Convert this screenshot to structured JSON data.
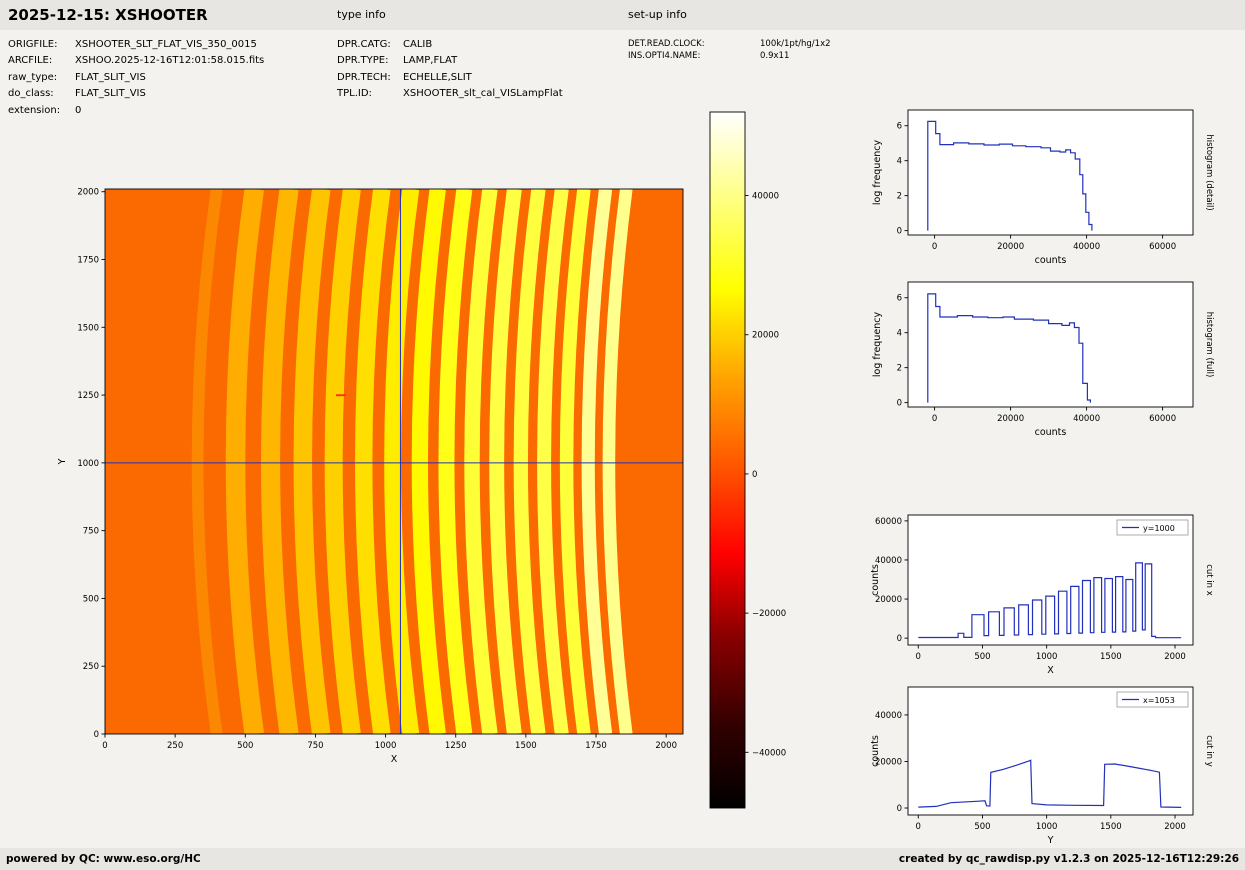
{
  "header": {
    "title": "2025-12-15: XSHOOTER",
    "type_info_label": "type info",
    "setup_info_label": "set-up info",
    "left_fields": [
      {
        "label": "ORIGFILE:",
        "value": "XSHOOTER_SLT_FLAT_VIS_350_0015"
      },
      {
        "label": "ARCFILE:",
        "value": "XSHOO.2025-12-16T12:01:58.015.fits"
      },
      {
        "label": "raw_type:",
        "value": "FLAT_SLIT_VIS"
      },
      {
        "label": "do_class:",
        "value": "FLAT_SLIT_VIS"
      },
      {
        "label": "extension:",
        "value": "0"
      }
    ],
    "type_fields": [
      {
        "label": "DPR.CATG:",
        "value": "CALIB"
      },
      {
        "label": "DPR.TYPE:",
        "value": "LAMP,FLAT"
      },
      {
        "label": "DPR.TECH:",
        "value": "ECHELLE,SLIT"
      },
      {
        "label": "TPL.ID:",
        "value": "XSHOOTER_slt_cal_VISLampFlat"
      }
    ],
    "setup_fields": [
      {
        "label": "DET.READ.CLOCK:",
        "value": "100k/1pt/hg/1x2"
      },
      {
        "label": "INS.OPTI4.NAME:",
        "value": "0.9x11"
      }
    ]
  },
  "footer": {
    "left": "powered by QC: www.eso.org/HC",
    "right": "created by qc_rawdisp.py v1.2.3 on 2025-12-16T12:29:26"
  },
  "chart_data": [
    {
      "id": "main_image",
      "type": "heatmap",
      "title": "",
      "xlabel": "X",
      "ylabel": "Y",
      "xlim": [
        0,
        2060
      ],
      "ylim": [
        0,
        2010
      ],
      "xticks": [
        0,
        250,
        500,
        750,
        1000,
        1250,
        1500,
        1750,
        2000
      ],
      "yticks": [
        0,
        250,
        500,
        750,
        1000,
        1250,
        1500,
        1750,
        2000
      ],
      "bg_color": "#fa6a00",
      "crosshair": {
        "x": 1053,
        "y": 1000,
        "color": "#2230bb"
      },
      "defects": [
        {
          "x": 840,
          "y": 1253,
          "w": 34,
          "h": 7,
          "color": "#fb2e00"
        }
      ],
      "orders": [
        {
          "x": 330,
          "width": 42,
          "bow": 68,
          "color": "#fc8700",
          "value": 6000
        },
        {
          "x": 465,
          "width": 70,
          "bow": 67,
          "color": "#ffad00",
          "value": 12000
        },
        {
          "x": 590,
          "width": 68,
          "bow": 66,
          "color": "#ffb600",
          "value": 13500
        },
        {
          "x": 705,
          "width": 66,
          "bow": 66,
          "color": "#ffc400",
          "value": 15500
        },
        {
          "x": 815,
          "width": 64,
          "bow": 65,
          "color": "#ffd000",
          "value": 17000
        },
        {
          "x": 922,
          "width": 62,
          "bow": 65,
          "color": "#ffdf00",
          "value": 19500
        },
        {
          "x": 1025,
          "width": 60,
          "bow": 65,
          "color": "#ffed00",
          "value": 21500
        },
        {
          "x": 1122,
          "width": 58,
          "bow": 64,
          "color": "#fffa00",
          "value": 24000
        },
        {
          "x": 1217,
          "width": 57,
          "bow": 64,
          "color": "#ffff18",
          "value": 26500
        },
        {
          "x": 1308,
          "width": 55,
          "bow": 64,
          "color": "#ffff38",
          "value": 29500
        },
        {
          "x": 1396,
          "width": 53,
          "bow": 63,
          "color": "#ffff44",
          "value": 31000
        },
        {
          "x": 1482,
          "width": 51,
          "bow": 63,
          "color": "#ffff3f",
          "value": 30500
        },
        {
          "x": 1565,
          "width": 50,
          "bow": 63,
          "color": "#ffff47",
          "value": 31500
        },
        {
          "x": 1645,
          "width": 48,
          "bow": 62,
          "color": "#ffff3a",
          "value": 30000
        },
        {
          "x": 1722,
          "width": 47,
          "bow": 62,
          "color": "#ffff95",
          "value": 38500
        },
        {
          "x": 1796,
          "width": 45,
          "bow": 62,
          "color": "#ffff8e",
          "value": 38000
        }
      ]
    },
    {
      "id": "colorbar",
      "type": "colorbar",
      "vmin": -48000,
      "vmax": 52000,
      "ticks": [
        {
          "value": 40000,
          "label": "40000"
        },
        {
          "value": 20000,
          "label": "20000"
        },
        {
          "value": 0,
          "label": "0"
        },
        {
          "value": -20000,
          "label": "−20000"
        },
        {
          "value": -40000,
          "label": "−40000"
        }
      ],
      "stops": [
        {
          "pos": 0,
          "color": "#000000"
        },
        {
          "pos": 0.12,
          "color": "#330000"
        },
        {
          "pos": 0.25,
          "color": "#8c0000"
        },
        {
          "pos": 0.365,
          "color": "#ff0000"
        },
        {
          "pos": 0.5,
          "color": "#ff5c00"
        },
        {
          "pos": 0.62,
          "color": "#ffa500"
        },
        {
          "pos": 0.746,
          "color": "#ffff00"
        },
        {
          "pos": 0.87,
          "color": "#ffff7d"
        },
        {
          "pos": 1,
          "color": "#ffffff"
        }
      ]
    },
    {
      "id": "hist_detail",
      "type": "line",
      "side_label": "histogram (detail)",
      "xlabel": "counts",
      "ylabel": "log frequency",
      "color": "#2230bb",
      "xlim": [
        -7000,
        68000
      ],
      "ylim": [
        -0.25,
        6.9
      ],
      "xticks": [
        0,
        20000,
        40000,
        60000
      ],
      "yticks": [
        0,
        2,
        4,
        6
      ],
      "points": [
        [
          -1800,
          0
        ],
        [
          -1800,
          6.25
        ],
        [
          300,
          6.25
        ],
        [
          300,
          5.55
        ],
        [
          1400,
          5.55
        ],
        [
          1400,
          4.92
        ],
        [
          5000,
          4.92
        ],
        [
          5000,
          5.02
        ],
        [
          9000,
          5.02
        ],
        [
          9000,
          4.96
        ],
        [
          13000,
          4.96
        ],
        [
          13000,
          4.9
        ],
        [
          17000,
          4.9
        ],
        [
          17000,
          4.95
        ],
        [
          20500,
          4.95
        ],
        [
          20500,
          4.85
        ],
        [
          24000,
          4.85
        ],
        [
          24000,
          4.8
        ],
        [
          28000,
          4.8
        ],
        [
          28000,
          4.74
        ],
        [
          30500,
          4.74
        ],
        [
          30500,
          4.55
        ],
        [
          33000,
          4.55
        ],
        [
          33000,
          4.5
        ],
        [
          34500,
          4.5
        ],
        [
          34500,
          4.62
        ],
        [
          35800,
          4.62
        ],
        [
          35800,
          4.45
        ],
        [
          37000,
          4.45
        ],
        [
          37000,
          4.1
        ],
        [
          38200,
          4.1
        ],
        [
          38200,
          3.2
        ],
        [
          39000,
          3.2
        ],
        [
          39000,
          2.1
        ],
        [
          39800,
          2.1
        ],
        [
          39800,
          1.05
        ],
        [
          40600,
          1.05
        ],
        [
          40600,
          0.35
        ],
        [
          41400,
          0.35
        ],
        [
          41400,
          0
        ]
      ]
    },
    {
      "id": "hist_full",
      "type": "line",
      "side_label": "histogram (full)",
      "xlabel": "counts",
      "ylabel": "log frequency",
      "color": "#2230bb",
      "xlim": [
        -7000,
        68000
      ],
      "ylim": [
        -0.25,
        6.9
      ],
      "xticks": [
        0,
        20000,
        40000,
        60000
      ],
      "yticks": [
        0,
        2,
        4,
        6
      ],
      "points": [
        [
          -1800,
          0
        ],
        [
          -1800,
          6.22
        ],
        [
          300,
          6.22
        ],
        [
          300,
          5.5
        ],
        [
          1400,
          5.5
        ],
        [
          1400,
          4.9
        ],
        [
          6000,
          4.9
        ],
        [
          6000,
          4.98
        ],
        [
          10000,
          4.98
        ],
        [
          10000,
          4.9
        ],
        [
          14000,
          4.9
        ],
        [
          14000,
          4.86
        ],
        [
          18000,
          4.86
        ],
        [
          18000,
          4.9
        ],
        [
          21000,
          4.9
        ],
        [
          21000,
          4.78
        ],
        [
          26000,
          4.78
        ],
        [
          26000,
          4.72
        ],
        [
          30000,
          4.72
        ],
        [
          30000,
          4.52
        ],
        [
          33500,
          4.52
        ],
        [
          33500,
          4.42
        ],
        [
          35500,
          4.42
        ],
        [
          35500,
          4.56
        ],
        [
          36800,
          4.56
        ],
        [
          36800,
          4.3
        ],
        [
          38000,
          4.3
        ],
        [
          38000,
          3.4
        ],
        [
          39000,
          3.4
        ],
        [
          39000,
          1.1
        ],
        [
          40200,
          1.1
        ],
        [
          40200,
          0.15
        ],
        [
          41000,
          0.15
        ],
        [
          41000,
          0
        ]
      ]
    },
    {
      "id": "cut_x",
      "type": "line",
      "side_label": "cut in x",
      "legend": "y=1000",
      "xlabel": "X",
      "ylabel": "counts",
      "color": "#2230bb",
      "xlim": [
        -80,
        2140
      ],
      "ylim": [
        -3500,
        63000
      ],
      "xticks": [
        0,
        500,
        1000,
        1500,
        2000
      ],
      "yticks": [
        0,
        20000,
        40000,
        60000
      ],
      "points": [
        [
          0,
          350
        ],
        [
          310,
          350
        ],
        [
          310,
          2500
        ],
        [
          355,
          2500
        ],
        [
          355,
          400
        ],
        [
          418,
          400
        ],
        [
          418,
          12000
        ],
        [
          512,
          12000
        ],
        [
          512,
          1300
        ],
        [
          548,
          1300
        ],
        [
          548,
          13500
        ],
        [
          632,
          13500
        ],
        [
          632,
          1400
        ],
        [
          668,
          1400
        ],
        [
          668,
          15500
        ],
        [
          748,
          15500
        ],
        [
          748,
          1600
        ],
        [
          782,
          1600
        ],
        [
          782,
          17000
        ],
        [
          858,
          17000
        ],
        [
          858,
          1800
        ],
        [
          890,
          1800
        ],
        [
          890,
          19500
        ],
        [
          962,
          19500
        ],
        [
          962,
          2000
        ],
        [
          993,
          2000
        ],
        [
          993,
          21500
        ],
        [
          1062,
          21500
        ],
        [
          1062,
          2200
        ],
        [
          1092,
          2200
        ],
        [
          1092,
          24000
        ],
        [
          1158,
          24000
        ],
        [
          1158,
          2400
        ],
        [
          1187,
          2400
        ],
        [
          1187,
          26500
        ],
        [
          1251,
          26500
        ],
        [
          1251,
          2600
        ],
        [
          1279,
          2600
        ],
        [
          1279,
          29500
        ],
        [
          1341,
          29500
        ],
        [
          1341,
          2800
        ],
        [
          1368,
          2800
        ],
        [
          1368,
          31000
        ],
        [
          1428,
          31000
        ],
        [
          1428,
          3000
        ],
        [
          1454,
          3000
        ],
        [
          1454,
          30500
        ],
        [
          1512,
          30500
        ],
        [
          1512,
          3100
        ],
        [
          1537,
          3100
        ],
        [
          1537,
          31500
        ],
        [
          1593,
          31500
        ],
        [
          1593,
          3200
        ],
        [
          1617,
          3200
        ],
        [
          1617,
          30000
        ],
        [
          1671,
          30000
        ],
        [
          1671,
          3600
        ],
        [
          1694,
          3600
        ],
        [
          1694,
          38500
        ],
        [
          1746,
          38500
        ],
        [
          1746,
          4200
        ],
        [
          1768,
          4200
        ],
        [
          1768,
          38000
        ],
        [
          1818,
          38000
        ],
        [
          1818,
          900
        ],
        [
          1848,
          900
        ],
        [
          1848,
          250
        ],
        [
          2048,
          250
        ]
      ]
    },
    {
      "id": "cut_y",
      "type": "line",
      "side_label": "cut in y",
      "legend": "x=1053",
      "xlabel": "Y",
      "ylabel": "counts",
      "color": "#2230bb",
      "xlim": [
        -80,
        2140
      ],
      "ylim": [
        -3000,
        52000
      ],
      "xticks": [
        0,
        500,
        1000,
        1500,
        2000
      ],
      "yticks": [
        0,
        20000,
        40000
      ],
      "points": [
        [
          0,
          400
        ],
        [
          140,
          700
        ],
        [
          255,
          2300
        ],
        [
          470,
          2950
        ],
        [
          520,
          3100
        ],
        [
          532,
          950
        ],
        [
          558,
          850
        ],
        [
          565,
          15300
        ],
        [
          660,
          16600
        ],
        [
          760,
          18300
        ],
        [
          858,
          20100
        ],
        [
          876,
          20500
        ],
        [
          886,
          1900
        ],
        [
          1000,
          1350
        ],
        [
          1210,
          1150
        ],
        [
          1444,
          1100
        ],
        [
          1452,
          18800
        ],
        [
          1530,
          18900
        ],
        [
          1620,
          18100
        ],
        [
          1710,
          17200
        ],
        [
          1800,
          16300
        ],
        [
          1878,
          15400
        ],
        [
          1890,
          450
        ],
        [
          2048,
          280
        ]
      ]
    }
  ]
}
